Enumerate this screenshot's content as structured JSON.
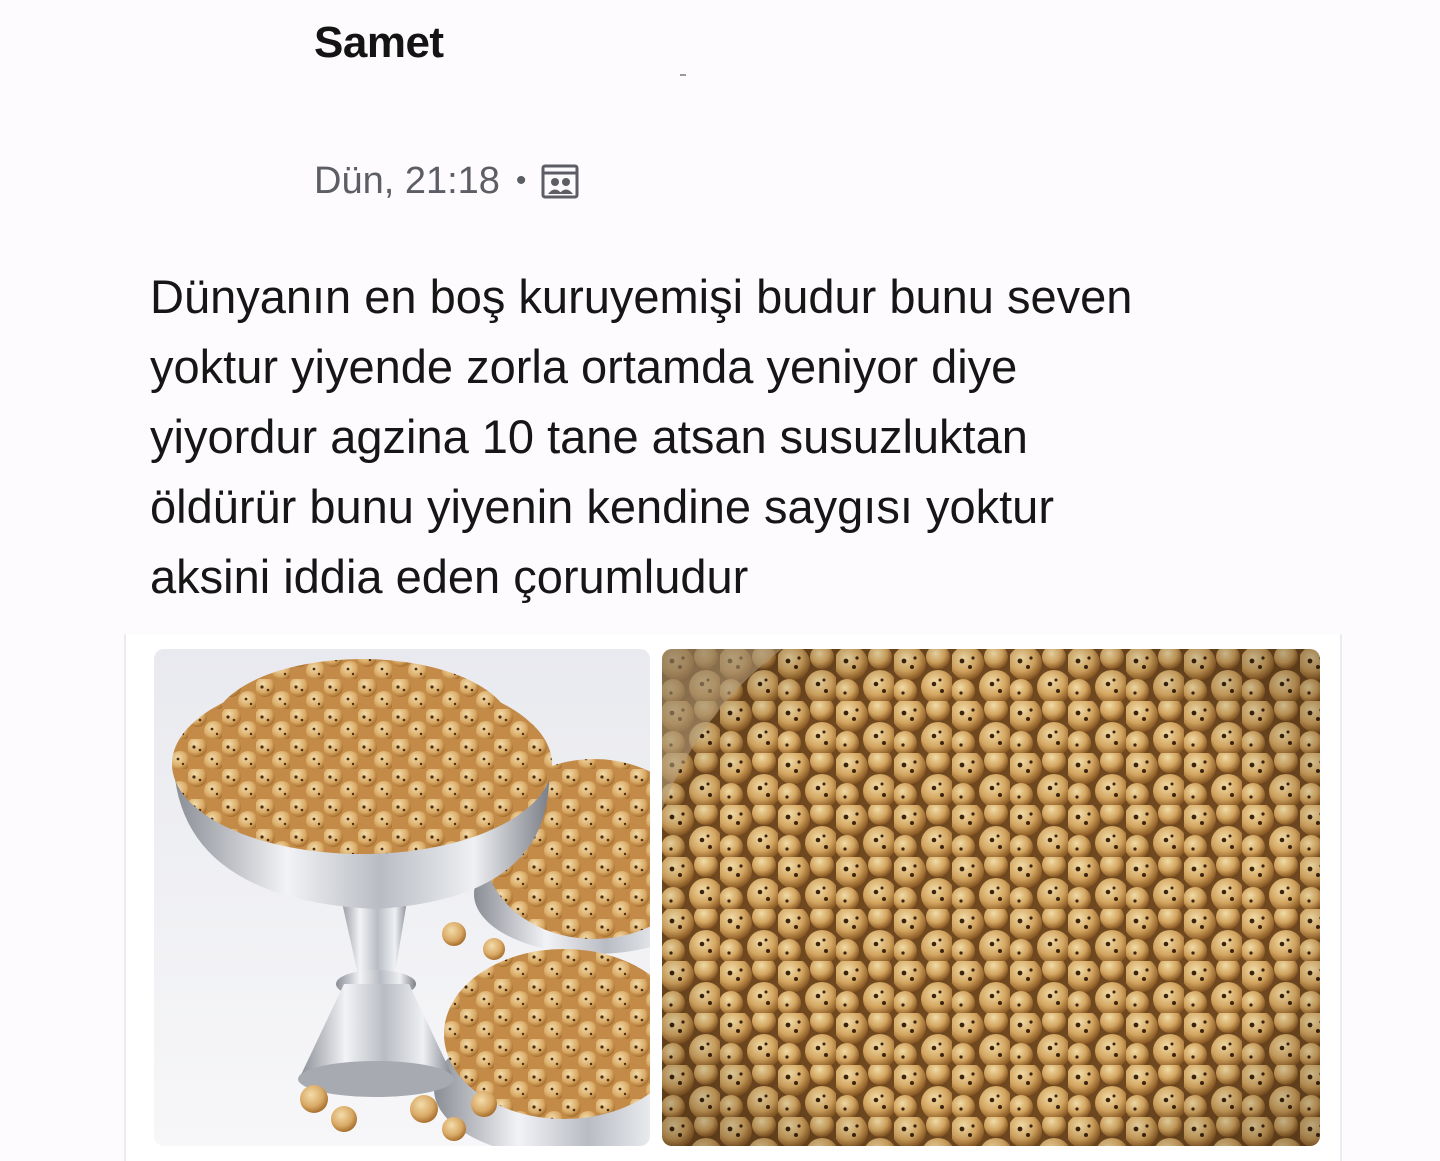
{
  "post": {
    "author": "Samet",
    "timestamp": "Dün, 21:18",
    "separator": "•",
    "audience_icon": "photo-album-icon",
    "text": "Dünyanın en boş kuruyemişi budur bunu seven\nyoktur yiyende zorla ortamda yeniyor diye\nyiyordur agzina 10 tane atsan susuzluktan\nöldürür bunu yiyenin kendine saygısı yoktur\naksini iddia eden çorumludur"
  },
  "media": {
    "count": 2,
    "photos": [
      {
        "subject": "roasted-chickpeas-in-silver-bowls"
      },
      {
        "subject": "roasted-chickpeas-closeup"
      }
    ]
  },
  "colors": {
    "background": "#fdfbfd",
    "text": "#161616",
    "meta": "#5d5d66",
    "chickpea_light": "#e8c98f",
    "chickpea_dark": "#b07a3a"
  }
}
